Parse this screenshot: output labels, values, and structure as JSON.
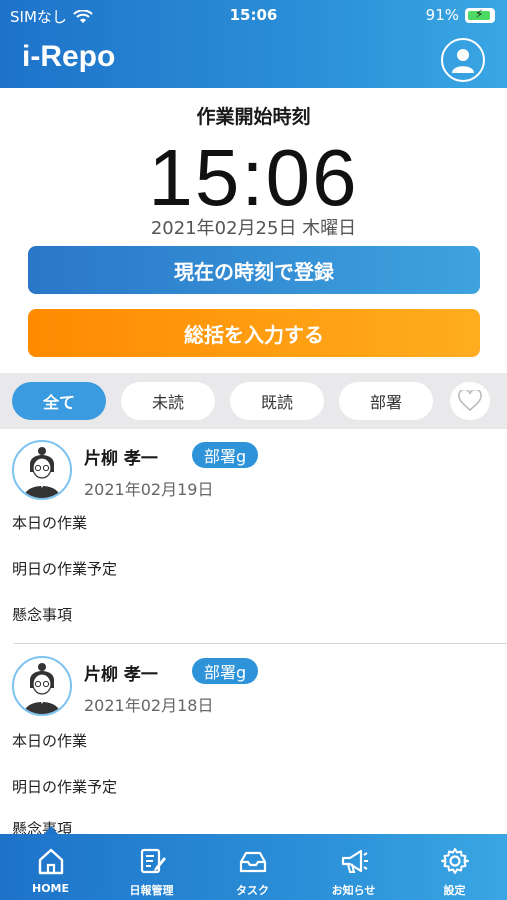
{
  "status_bar": {
    "carrier": "SIMなし",
    "time": "15:06",
    "battery": "91%"
  },
  "header": {
    "title": "i-Repo"
  },
  "start": {
    "label": "作業開始時刻",
    "time": "15:06",
    "date": "2021年02月25日 木曜日",
    "register_button": "現在の時刻で登録",
    "summary_button": "総括を入力する"
  },
  "filters": {
    "all": "全て",
    "unread": "未読",
    "read": "既読",
    "department": "部署",
    "active": "全て"
  },
  "reports": [
    {
      "author": "片柳 孝一",
      "department": "部署g",
      "date": "2021年02月19日",
      "lines": [
        "本日の作業",
        "明日の作業予定",
        "懸念事項"
      ]
    },
    {
      "author": "片柳 孝一",
      "department": "部署g",
      "date": "2021年02月18日",
      "lines": [
        "本日の作業",
        "明日の作業予定",
        "懸念事項"
      ]
    }
  ],
  "tabbar": {
    "items": [
      {
        "label": "HOME",
        "icon": "home-icon"
      },
      {
        "label": "日報管理",
        "icon": "report-edit-icon"
      },
      {
        "label": "タスク",
        "icon": "inbox-tray-icon"
      },
      {
        "label": "お知らせ",
        "icon": "megaphone-icon"
      },
      {
        "label": "設定",
        "icon": "gear-icon"
      }
    ],
    "active": "HOME"
  },
  "colors": {
    "header": "#1e73c9",
    "accent": "#3a9be0",
    "orange": "#ff8a00"
  }
}
